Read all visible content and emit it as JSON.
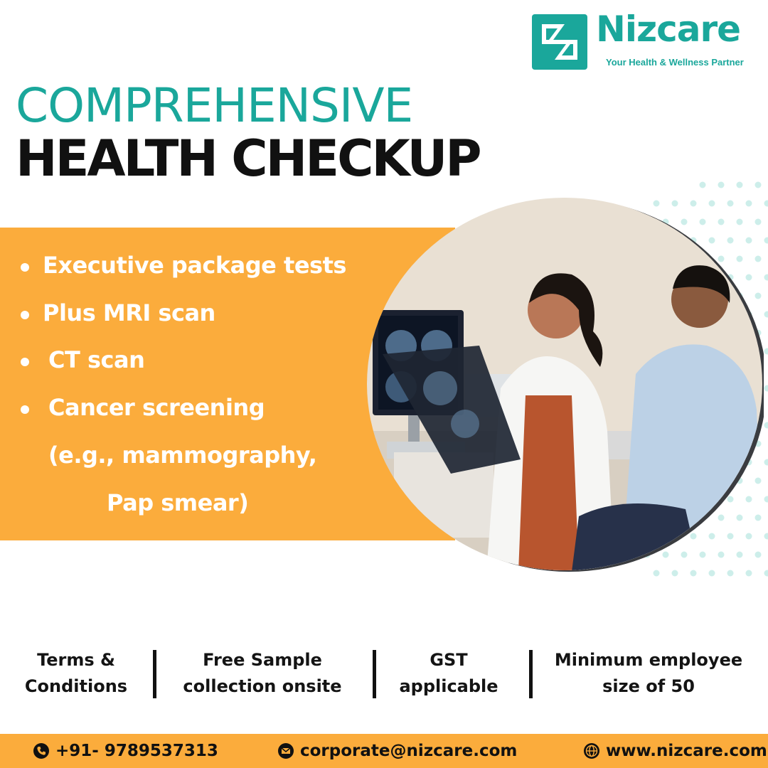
{
  "brand": {
    "name": "Nizcare",
    "tagline": "Your Health & Wellness Partner",
    "color": "#1aa79b"
  },
  "headline": {
    "line1": "COMPREHENSIVE",
    "line2": "HEALTH CHECKUP"
  },
  "features": [
    "Executive package tests",
    "Plus MRI scan",
    "CT scan",
    "Cancer screening",
    "(e.g., mammography,",
    "Pap smear)"
  ],
  "info": [
    {
      "line1": "Terms &",
      "line2": "Conditions"
    },
    {
      "line1": "Free Sample",
      "line2": "collection onsite"
    },
    {
      "line1": "GST",
      "line2": "applicable"
    },
    {
      "line1": "Minimum employee",
      "line2": "size of 50"
    }
  ],
  "footer": {
    "phone": "+91- 9789537313",
    "email": "corporate@nizcare.com",
    "website": "www.nizcare.com"
  },
  "icons": {
    "phone": "phone-icon",
    "email": "mail-icon",
    "website": "globe-icon"
  },
  "colors": {
    "accent_orange": "#fbac3c",
    "teal": "#1aa79b",
    "dot_teal": "#cdeeea"
  }
}
